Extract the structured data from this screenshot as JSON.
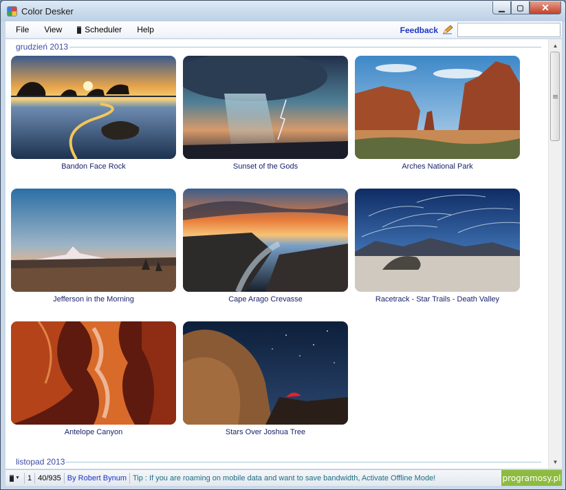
{
  "window": {
    "title": "Color Desker",
    "controls": {
      "minimize": "▁",
      "maximize": "▢",
      "close": "✕"
    }
  },
  "menu": {
    "items": [
      {
        "label": "File"
      },
      {
        "label": "View"
      },
      {
        "label": "Scheduler",
        "icon": "scheduler-icon"
      },
      {
        "label": "Help"
      }
    ],
    "feedback_label": "Feedback",
    "feedback_icon": "pencil-icon",
    "search": {
      "value": "",
      "placeholder": ""
    }
  },
  "groups": [
    {
      "label": "grudzień 2013",
      "items": [
        {
          "title": "Bandon Face Rock"
        },
        {
          "title": "Sunset of the Gods"
        },
        {
          "title": "Arches National Park"
        },
        {
          "title": "Jefferson in the Morning"
        },
        {
          "title": "Cape Arago Crevasse"
        },
        {
          "title": "Racetrack - Star Trails - Death Valley"
        },
        {
          "title": "Antelope Canyon"
        },
        {
          "title": "Stars Over Joshua Tree"
        }
      ]
    },
    {
      "label": "listopad 2013",
      "items": []
    }
  ],
  "status": {
    "scheduler_icon": "scheduler-icon",
    "count_a": "1",
    "count_b": "40/935",
    "author": "By Robert Bynum",
    "tip": "Tip : If you are roaming on mobile data and want to save bandwidth, Activate Offline Mode!",
    "badge": "programosy.pl"
  },
  "colors": {
    "accent_link": "#1b34c8",
    "group_header": "#3a4aa6",
    "caption": "#18226b",
    "tip": "#1d6f84",
    "badge": "#8dbb3f"
  }
}
